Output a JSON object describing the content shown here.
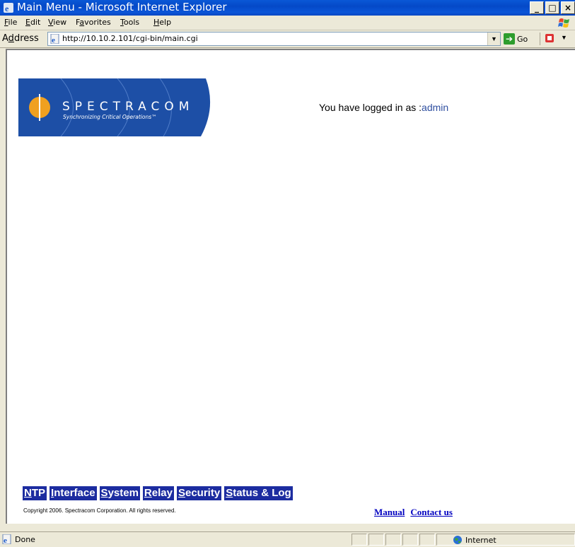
{
  "window": {
    "title": "Main Menu - Microsoft Internet Explorer",
    "min": "_",
    "max": "□",
    "close": "×"
  },
  "menubar": {
    "items": [
      {
        "pre": "",
        "u": "F",
        "post": "ile"
      },
      {
        "pre": "",
        "u": "E",
        "post": "dit"
      },
      {
        "pre": "",
        "u": "V",
        "post": "iew"
      },
      {
        "pre": "F",
        "u": "a",
        "post": "vorites"
      },
      {
        "pre": "",
        "u": "T",
        "post": "ools"
      },
      {
        "pre": "",
        "u": "H",
        "post": "elp"
      }
    ]
  },
  "address": {
    "label_pre": "A",
    "label_u": "d",
    "label_post": "dress",
    "url": "http://10.10.2.101/cgi-bin/main.cgi",
    "go_label": "Go"
  },
  "page": {
    "logo_text": "SPECTRACOM",
    "logo_tagline": "Synchronizing Critical Operations™",
    "logged_in_prefix": "You have logged in as :",
    "username": "admin",
    "nav": [
      {
        "u": "N",
        "rest": "TP"
      },
      {
        "u": "I",
        "rest": "nterface"
      },
      {
        "u": "S",
        "rest": "ystem"
      },
      {
        "u": "R",
        "rest": "elay"
      },
      {
        "u": "S",
        "rest": "ecurity"
      },
      {
        "u": "S",
        "rest": "tatus & Log"
      }
    ],
    "copyright": "Copyright 2006. Spectracom Corporation. All rights reserved.",
    "links": {
      "manual": "Manual",
      "contact": "Contact us"
    }
  },
  "status": {
    "text": "Done",
    "zone": "Internet"
  },
  "colors": {
    "title_blue": "#0449c8",
    "nav_bg": "#1c2ca0",
    "link": "#0000c0",
    "logo_blue": "#1d4fa6"
  }
}
